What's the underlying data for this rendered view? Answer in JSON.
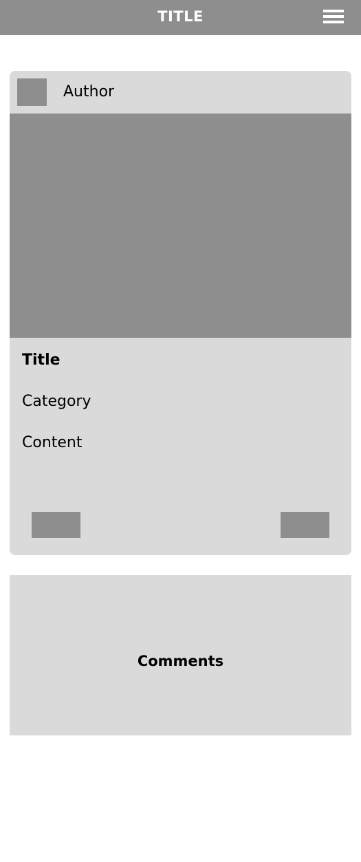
{
  "header": {
    "title": "TITLE",
    "menu_icon": "hamburger-menu-icon"
  },
  "post": {
    "author": "Author",
    "title": "Title",
    "category": "Category",
    "content": "Content"
  },
  "comments": {
    "label": "Comments"
  },
  "colors": {
    "bar": "#8e8e8e",
    "card": "#dadada",
    "background": "#ffffff",
    "header_text": "#ffffff"
  }
}
